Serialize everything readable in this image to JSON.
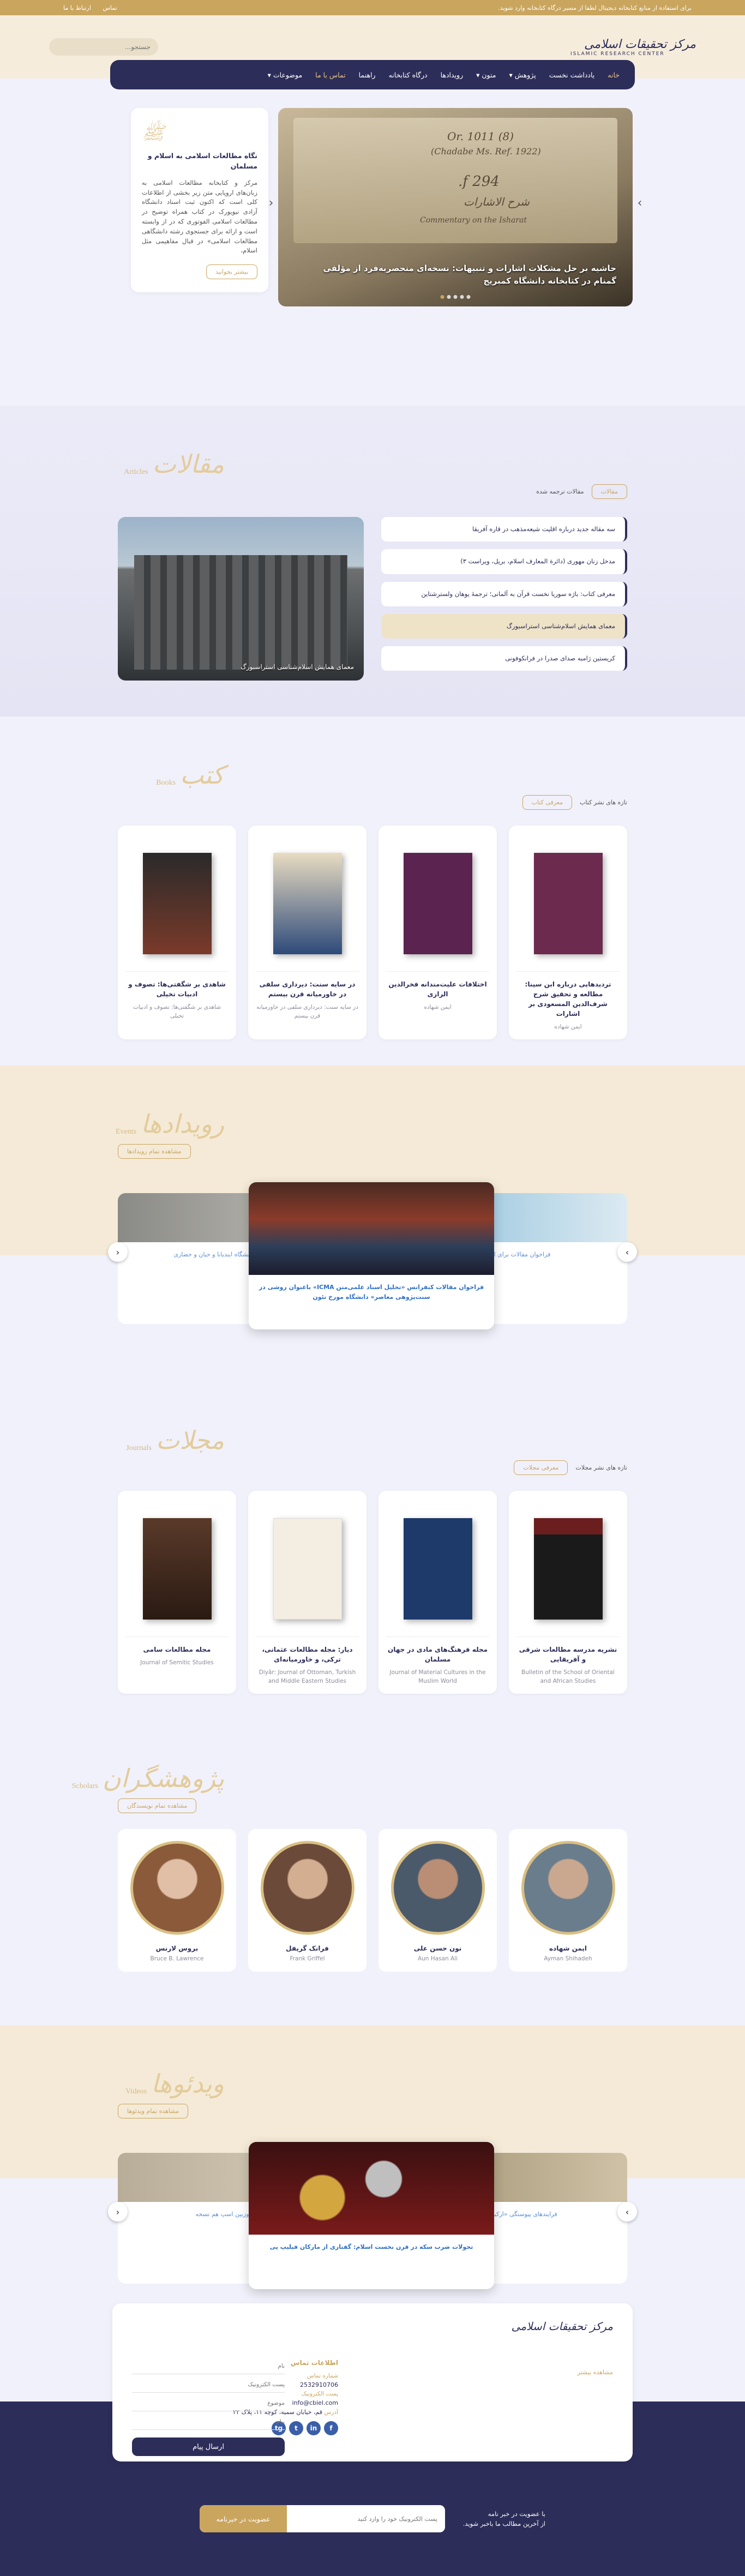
{
  "topbar": {
    "notice": "برای استفاده از منابع کتابخانه دیجیتال لطفا از مسیر درگاه کتابخانه وارد شوید.",
    "links": [
      "تماس",
      "ارتباط با ما"
    ]
  },
  "header": {
    "logo_text": "مرکز تحقیقات اسلامی",
    "logo_sub": "ISLAMIC RESEARCH CENTER",
    "search_placeholder": "جستجو..."
  },
  "nav": {
    "items": [
      "خانه",
      "یادداشت نخست",
      "پژوهش ▾",
      "متون ▾",
      "رویدادها",
      "درگاه کتابخانه",
      "راهنما",
      "تماس با ما",
      "موضوعات ▾"
    ]
  },
  "hero": {
    "slide_caption": "حاشیه بر حل مشکلات اشارات و تنبیهات: نسخه‌ای منحصربه‌فرد از مؤلفی گمنام در کتابخانه دانشگاه کمبریج",
    "manuscript_lines": [
      "Or. 1011 (8)",
      "(Chadabe Ms. Ref. 1922)",
      "294 f.",
      "شرح الاشارات",
      "Commentary on the Isharat"
    ],
    "intro_title": "نگاه مطالعات اسلامی به اسلام و مسلمان",
    "intro_text": "مرکز و کتابخانه مطالعات اسلامی به زبان‌های اروپایی متن زیر بخشی از اطلاعات کلی است که اکنون ثبت اسناد دانشگاه آزادی نیویورک در کتاب همراه توضیح در مطالعات اسلامی الفوتوری که در از وابسته است و ارائه برای جستجوی رشته دانشگاهی مطالعات اسلامی» در قبال مفاهیمی مثل اسلام،",
    "intro_button": "بیشتر بخوانید"
  },
  "articles": {
    "title_cal": "مقالات",
    "title_en": "Articles",
    "tag": "مقالات",
    "sub": "مقالات ترجمه شده",
    "items": [
      "سه مقاله جدید درباره اقلیت شیعه‌مذهب در قاره آفریقا",
      "مدخل زنان مهوری (دائرة المعارف اسلام، بریل، ویراست ۳)",
      "معرفی کتاب: باژه سوریا نخست قرآن به آلمانی؛ ترجمهٔ یوهان ولسترشتاین",
      "معمای همایش اسلام‌شناسی استراسبورگ",
      "کریستین ژامبه صدای صدرا در فرانکوفونی"
    ],
    "selected_index": 3,
    "image_caption": "معمای همایش اسلام‌شناسی استراسبورگ"
  },
  "books": {
    "title_cal": "کتب",
    "title_en": "Books",
    "tag": "معرفی کتاب",
    "sub": "تازه های نشر کتاب",
    "items": [
      {
        "title": "تردیدهایی درباره ابن سینا: مطالعه و تحقیق شرح شرف‌الدین المسعودی بر اشارات",
        "author": "ایمن شهاده",
        "color": "#6b2a4e"
      },
      {
        "title": "اختلافات علیت‌مندانه فخرالدین الرازی",
        "author": "ایمن شهاده",
        "color": "#5a2350"
      },
      {
        "title": "در سایه سنت: دیرداری سلفی در خاورمیانه قرن بیستم",
        "author": "در سایه سنت: دیرداری سلفی در خاورمیانه قرن بیستم",
        "color": "#c8a46a"
      },
      {
        "title": "شاهدی بر شگفتی‌ها: تصوف و ادبیات تخیلی",
        "author": "شاهدی بر شگفتی‌ها: تصوف و ادبیات تخیلی",
        "color": "#2a2a2a"
      }
    ]
  },
  "events": {
    "title_cal": "رویدادها",
    "title_en": "Events",
    "tag": "مشاهده تمام رویدادها",
    "items": [
      "فراخوان مقالات برای انتشار متون ویژه",
      "فراخوان مقالات کنفرانس «تحلیل اسناد علمی‌متن ICMA» باعنوان روشی در سنت‌پژوهی معاصر» دانشگاه مورخ تئون",
      "بررسی و جامعه مدرن، دانشگاه ایندیانا و حیان و حضاری"
    ]
  },
  "journals": {
    "title_cal": "مجلات",
    "title_en": "Journals",
    "tag": "معرفی مجلات",
    "sub": "تازه های نشر مجلات",
    "items": [
      {
        "title": "نشریه مدرسه مطالعات شرقی و آفریقایی",
        "author": "Bulletin of the School of Oriental and African Studies",
        "color": "#6b1e1e"
      },
      {
        "title": "مجله فرهنگ‌های مادی در جهان مسلمان",
        "author": "Journal of Material Cultures in the Muslim World",
        "color": "#1e3a6b"
      },
      {
        "title": "دیار: مجله مطالعات عثمانی، ترکی، و خاورمیانه‌ای",
        "author": "Diyâr: Journal of Ottoman, Turkish and Middle Eastern Studies",
        "color": "#f3ede2"
      },
      {
        "title": "مجله مطالعات سامی",
        "author": "Journal of Semitic Studies",
        "color": "#5a3a2a"
      }
    ]
  },
  "scholars": {
    "title_cal": "پژوهشگران",
    "title_en": "Scholars",
    "tag": "مشاهده تمام نویسندگان",
    "items": [
      {
        "name": "ایمن شهاده",
        "en": "Ayman Shihadeh",
        "color": "#6a7d8c"
      },
      {
        "name": "نون حسن علی",
        "en": "Aun Hasan Ali",
        "color": "#4a5a6a"
      },
      {
        "name": "فرانک گریفل",
        "en": "Frank Griffel",
        "color": "#6b4a3a"
      },
      {
        "name": "بروس لارنس",
        "en": "Bruce B. Lawrence",
        "color": "#8a5a3a"
      }
    ]
  },
  "videos": {
    "title_cal": "ویدئوها",
    "title_en": "Videos",
    "tag": "مشاهده تمام ویدئوها",
    "items": [
      "فرایندهای پیوستگی «ارکبا» در شرق اسلامی",
      "تحولات ضرب سکه در قرن نخست اسلام: گفتاری از مارکان فیلیپ پی",
      "در حاشیه متون دوزبین اسپ هم تسخه"
    ]
  },
  "footer": {
    "logo_text": "مرکز تحقیقات اسلامی",
    "more": "مشاهده بیشتر",
    "contact_title": "اطلاعات تماس",
    "phone_label": "شماره تماس",
    "phone": "2532910706",
    "email_label": "پست الکترونیک",
    "email": "info@cbiel.com",
    "address_label": "آدرس",
    "address": "قم، خیابان سمیه، کوچه ۱۱، پلاک ۲۲",
    "form": {
      "name": "نام",
      "email": "پست الکترونیک",
      "subject": "موضوع",
      "message": "پیام",
      "send": "ارسال پیام"
    },
    "social": [
      "f",
      "in",
      "t",
      "tg"
    ],
    "newsletter_title": "با عضویت در خبر نامه",
    "newsletter_text": "از آخرین مطالب ما باخبر شوید.",
    "newsletter_placeholder": "پست الکترونیک خود را وارد کنید",
    "newsletter_button": "عضویت در خبرنامه"
  }
}
